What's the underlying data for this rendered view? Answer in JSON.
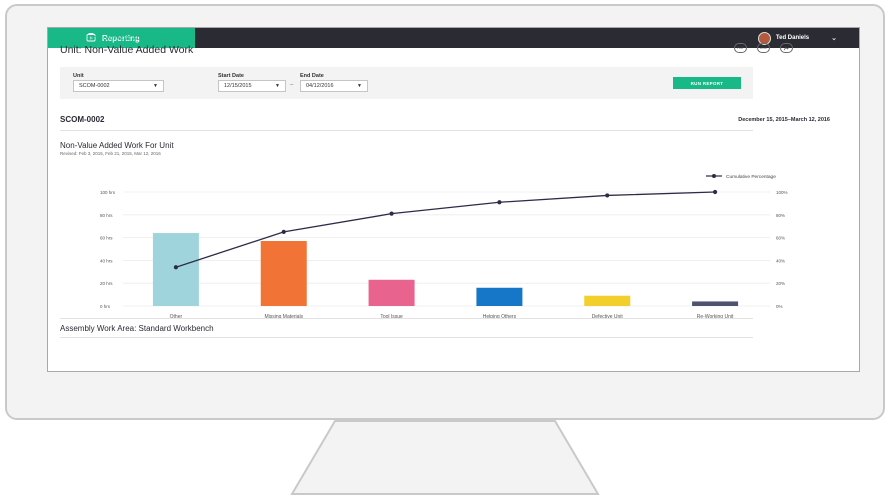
{
  "header": {
    "app_title": "Reporting",
    "user_name": "Ted Daniels"
  },
  "breadcrumb": {
    "root": "MAIN",
    "separator": ">",
    "current": "UNIT: NON-VALUE ADDED WORK"
  },
  "page": {
    "title": "Unit: Non-Value Added Work",
    "export_buttons": [
      "PDF",
      "CSV",
      ""
    ]
  },
  "filters": {
    "unit_label": "Unit",
    "unit_value": "SCOM-0002",
    "start_label": "Start Date",
    "start_value": "12/15/2015",
    "end_label": "End Date",
    "end_value": "04/12/2016",
    "separator": "–",
    "run_label": "RUN REPORT"
  },
  "report": {
    "unit_code": "SCOM-0002",
    "date_range": "December 15, 2015–March 12, 2016",
    "second_section_title": "Assembly Work Area: Standard Workbench"
  },
  "chart_data": {
    "type": "bar",
    "title": "Non-Value Added Work For Unit",
    "subtitle": "Revised: Feb 3, 2015, Feb 21, 2015, Mar 12, 2016",
    "categories": [
      "Other",
      "Missing Materials",
      "Tool Issue",
      "Helping Others",
      "Defective Unit",
      "Re-Working Unit"
    ],
    "values": [
      64,
      57,
      23,
      16,
      9,
      4
    ],
    "bar_colors": [
      "#9fd4dc",
      "#f17335",
      "#e8648f",
      "#1677c8",
      "#f2cf2a",
      "#4f5270"
    ],
    "line": {
      "name": "Cumulative Percentage",
      "values": [
        34,
        65,
        81,
        91,
        97,
        100
      ],
      "color": "#2d2c48"
    },
    "y_left": {
      "ylim": [
        0,
        100
      ],
      "ticks": [
        0,
        20,
        40,
        60,
        80,
        100
      ],
      "tick_labels": [
        "0 hrs",
        "20 hrs",
        "40 hrs",
        "60 hrs",
        "80 hrs",
        "100 hrs"
      ]
    },
    "y_right": {
      "ylim": [
        0,
        100
      ],
      "ticks": [
        0,
        20,
        40,
        60,
        80,
        100
      ],
      "tick_labels": [
        "0%",
        "20%",
        "40%",
        "60%",
        "80%",
        "100%"
      ]
    },
    "grid": true,
    "legend_position": "top-right"
  },
  "colors": {
    "accent": "#19b887",
    "topbar": "#2a2b33"
  }
}
